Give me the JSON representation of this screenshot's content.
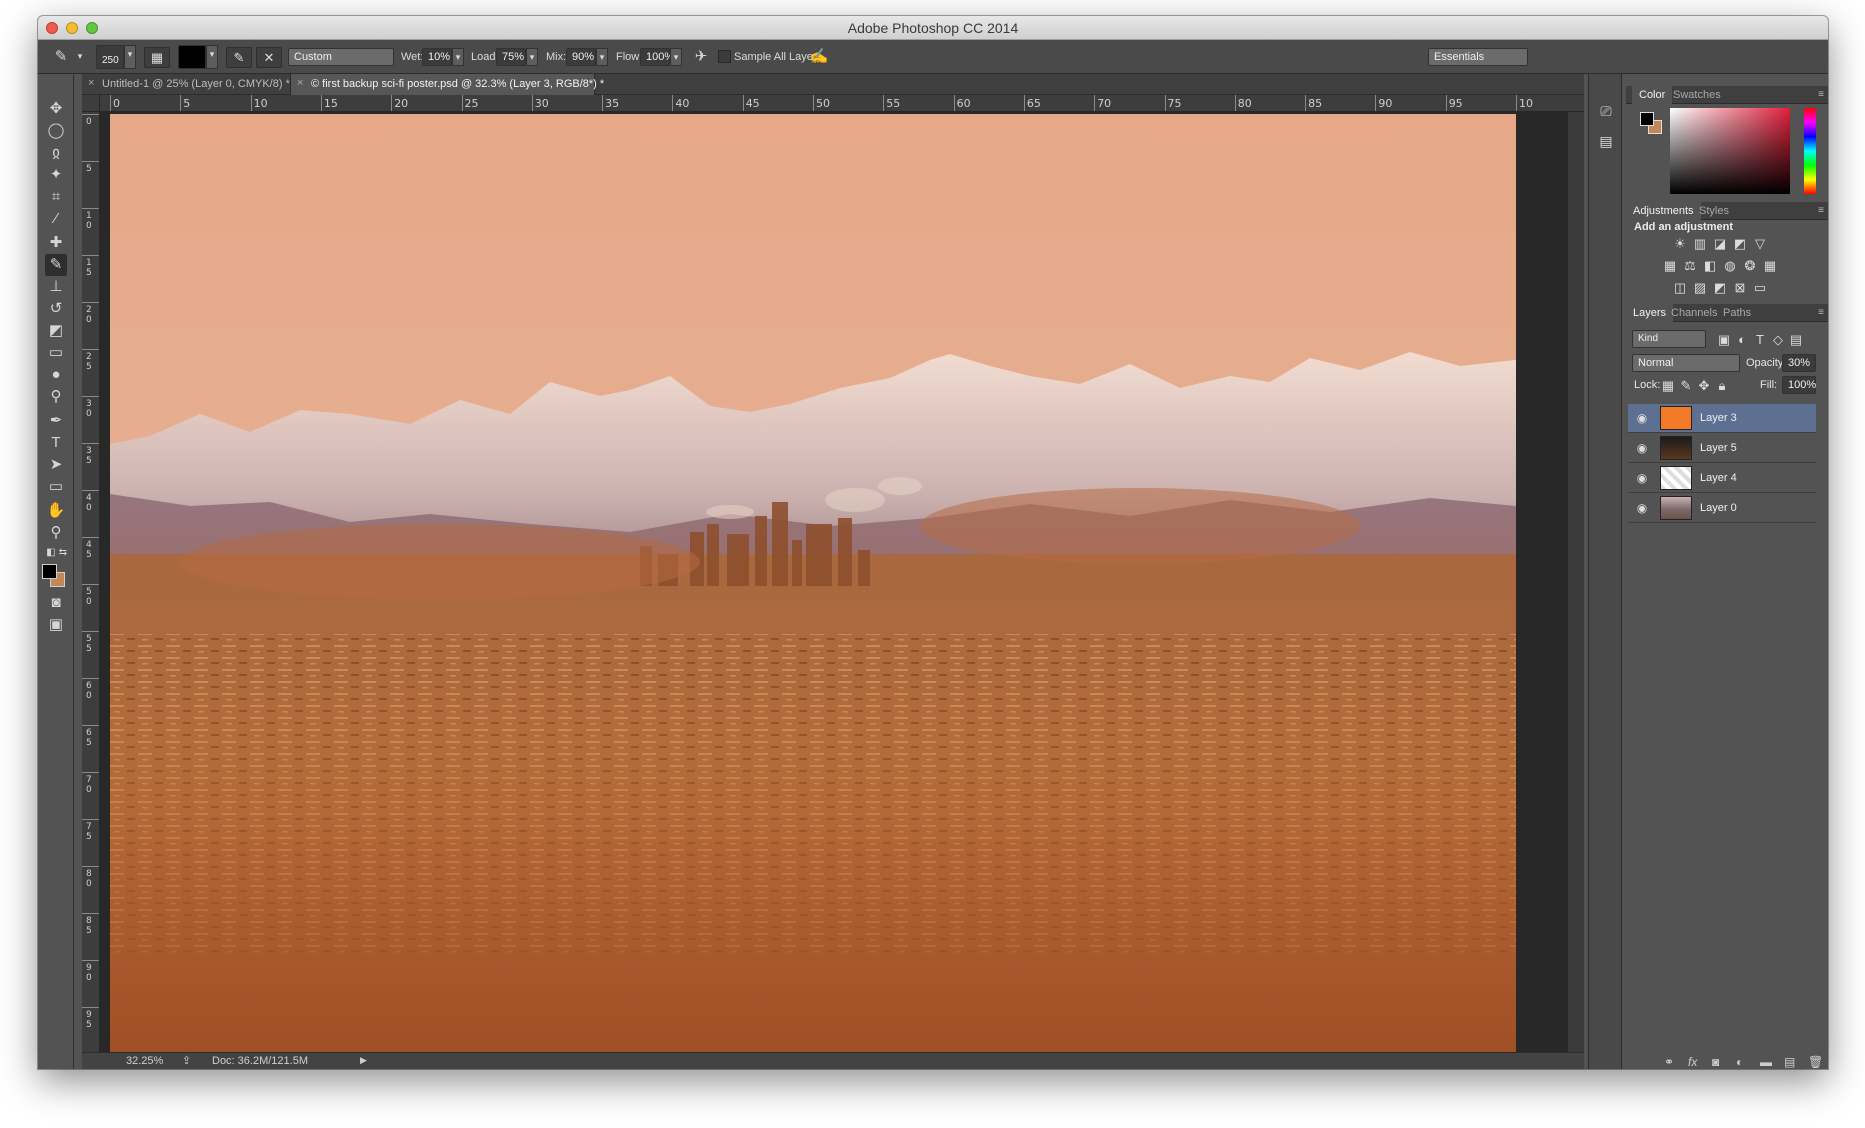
{
  "window": {
    "title": "Adobe Photoshop CC 2014"
  },
  "options_bar": {
    "brush_size": "250",
    "mixer_preset": "Custom",
    "wet_label": "Wet:",
    "wet_value": "10%",
    "load_label": "Load:",
    "load_value": "75%",
    "mix_label": "Mix:",
    "mix_value": "90%",
    "flow_label": "Flow:",
    "flow_value": "100%",
    "sample_all_label": "Sample All Layers",
    "workspace": "Essentials"
  },
  "tabs": [
    {
      "label": "Untitled-1 @ 25% (Layer 0, CMYK/8) *"
    },
    {
      "label": "© first backup sci-fi poster.psd @ 32.3% (Layer 3, RGB/8*) *"
    }
  ],
  "ruler": {
    "h_ticks": [
      "0",
      "5",
      "10",
      "15",
      "20",
      "25",
      "30",
      "35",
      "40",
      "45",
      "50",
      "55",
      "60",
      "65",
      "70",
      "75",
      "80",
      "85",
      "90",
      "95",
      "10"
    ],
    "v_ticks": [
      "0",
      "5",
      "1\n0",
      "1\n5",
      "2\n0",
      "2\n5",
      "3\n0",
      "3\n5",
      "4\n0",
      "4\n5",
      "5\n0",
      "5\n5",
      "6\n0",
      "6\n5",
      "7\n0",
      "7\n5",
      "8\n0",
      "8\n5",
      "9\n0",
      "9\n5"
    ]
  },
  "status": {
    "zoom": "32.25%",
    "doc": "Doc: 36.2M/121.5M"
  },
  "color_panel": {
    "tab_color": "Color",
    "tab_swatches": "Swatches",
    "foreground": "#000000",
    "background": "#c48757"
  },
  "adjustments_panel": {
    "tab_adjustments": "Adjustments",
    "tab_styles": "Styles",
    "heading": "Add an adjustment"
  },
  "layers_panel": {
    "tab_layers": "Layers",
    "tab_channels": "Channels",
    "tab_paths": "Paths",
    "filter_kind": "Kind",
    "blend_mode": "Normal",
    "opacity_label": "Opacity:",
    "opacity_value": "30%",
    "lock_label": "Lock:",
    "fill_label": "Fill:",
    "fill_value": "100%",
    "layers": [
      {
        "name": "Layer 3",
        "selected": true
      },
      {
        "name": "Layer 5",
        "selected": false
      },
      {
        "name": "Layer 4",
        "selected": false
      },
      {
        "name": "Layer 0",
        "selected": false
      }
    ]
  }
}
